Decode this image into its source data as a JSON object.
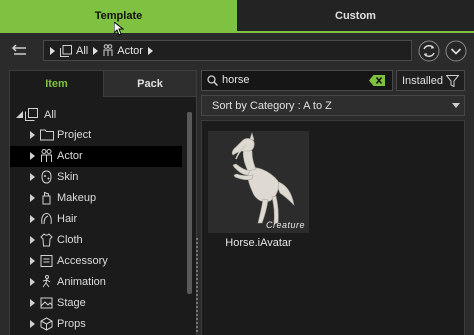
{
  "tabs": {
    "template": "Template",
    "custom": "Custom"
  },
  "breadcrumb": {
    "segments": [
      "All",
      "Actor"
    ]
  },
  "left_panel": {
    "tabs": {
      "item": "Item",
      "pack": "Pack"
    },
    "tree": {
      "root": "All",
      "items": [
        {
          "label": "Project",
          "icon": "folder-icon"
        },
        {
          "label": "Actor",
          "icon": "actor-icon",
          "selected": true
        },
        {
          "label": "Skin",
          "icon": "skin-icon"
        },
        {
          "label": "Makeup",
          "icon": "makeup-icon"
        },
        {
          "label": "Hair",
          "icon": "hair-icon"
        },
        {
          "label": "Cloth",
          "icon": "cloth-icon"
        },
        {
          "label": "Accessory",
          "icon": "accessory-icon"
        },
        {
          "label": "Animation",
          "icon": "animation-icon"
        },
        {
          "label": "Stage",
          "icon": "stage-icon"
        },
        {
          "label": "Props",
          "icon": "props-icon"
        }
      ]
    }
  },
  "search": {
    "value": "horse"
  },
  "filter": {
    "installed_label": "Installed"
  },
  "sort": {
    "selected": "Sort by Category : A to Z"
  },
  "results": [
    {
      "label": "Horse.iAvatar",
      "tag": "Creature",
      "icon": "horse-thumbnail"
    }
  ],
  "colors": {
    "accent": "#7fc241",
    "background": "#2b2b2b",
    "panel": "#1b1b1b",
    "selected_row": "#000000"
  }
}
